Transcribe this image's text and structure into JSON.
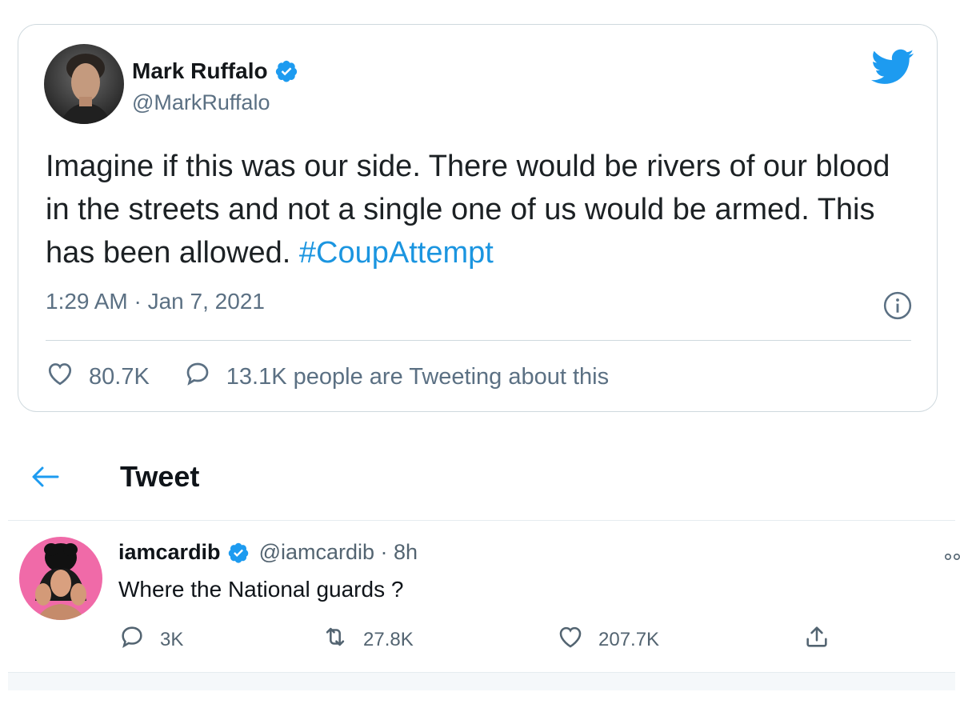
{
  "embed": {
    "author_name": "Mark Ruffalo",
    "author_handle": "@MarkRuffalo",
    "text_main": "Imagine if this was our side. There would be rivers of our blood in the streets and not a single one of us would be armed. This has been allowed.",
    "hashtag": "#CoupAttempt",
    "timestamp": "1:29 AM · Jan 7, 2021",
    "likes": "80.7K",
    "tweeting_about": "13.1K people are Tweeting about this",
    "icons": {
      "verified": "verified-badge-icon",
      "bird": "twitter-bird-icon",
      "info": "info-icon",
      "like": "heart-icon",
      "reply": "speech-bubble-icon"
    }
  },
  "header": {
    "title": "Tweet",
    "back_icon": "back-arrow-icon"
  },
  "reply": {
    "author_name": "iamcardib",
    "author_handle": "@iamcardib · 8h",
    "text": "Where the National guards ?",
    "replies": "3K",
    "retweets": "27.8K",
    "likes": "207.7K",
    "icons": {
      "reply": "reply-icon",
      "retweet": "retweet-icon",
      "like": "heart-icon",
      "share": "share-icon",
      "more": "more-icon"
    }
  },
  "colors": {
    "twitter_blue": "#1d9bf0",
    "hashtag": "#1b95e0",
    "secondary_text": "#5b7083",
    "border": "#cfd9de"
  }
}
